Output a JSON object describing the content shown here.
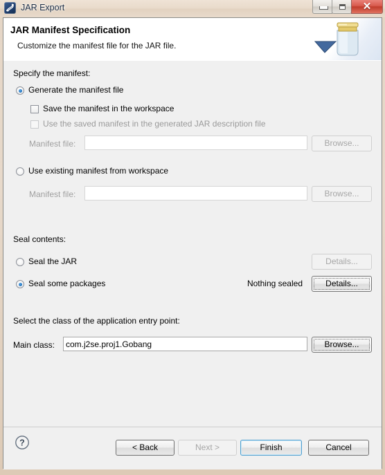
{
  "window": {
    "title": "JAR Export",
    "app_icon": "jar-export-icon",
    "controls": {
      "minimize": "minimize-icon",
      "maximize": "maximize-icon",
      "close": "✕"
    }
  },
  "banner": {
    "title": "JAR Manifest Specification",
    "subtitle": "Customize the manifest file for the JAR file.",
    "artwork": "jar-bottle-icon"
  },
  "sections": {
    "manifest": {
      "label": "Specify the manifest:",
      "generate_radio": {
        "label": "Generate the manifest file",
        "checked": true,
        "enabled": true
      },
      "save_checkbox": {
        "label": "Save the manifest in the workspace",
        "checked": false,
        "enabled": true
      },
      "use_saved_checkbox": {
        "label": "Use the saved manifest in the generated JAR description file",
        "checked": false,
        "enabled": false
      },
      "manifest_file_label": "Manifest file:",
      "manifest_file_value": "",
      "manifest_file_placeholder": "",
      "browse_label": "Browse...",
      "use_existing_radio": {
        "label": "Use existing manifest from workspace",
        "checked": false,
        "enabled": true
      },
      "manifest_file_label2": "Manifest file:",
      "manifest_file_value2": "",
      "browse_label2": "Browse..."
    },
    "seal": {
      "label": "Seal contents:",
      "seal_jar_radio": {
        "label": "Seal the JAR",
        "checked": false,
        "enabled": true
      },
      "seal_jar_details": "Details...",
      "seal_packages_radio": {
        "label": "Seal some packages",
        "checked": true,
        "enabled": true
      },
      "seal_packages_status": "Nothing sealed",
      "seal_packages_details": "Details..."
    },
    "entry_point": {
      "label": "Select the class of the application entry point:",
      "main_class_label": "Main class:",
      "main_class_value": "com.j2se.proj1.Gobang",
      "browse_label": "Browse..."
    }
  },
  "footer": {
    "help": "?",
    "back": "< Back",
    "next": "Next >",
    "finish": "Finish",
    "cancel": "Cancel"
  },
  "colors": {
    "accent_blue": "#1f6fb8",
    "default_button_border": "#4f9fcf",
    "close_button": "#c03c2c",
    "dialog_bg": "#f0f0f0",
    "disabled_text": "#9a9a9a"
  }
}
